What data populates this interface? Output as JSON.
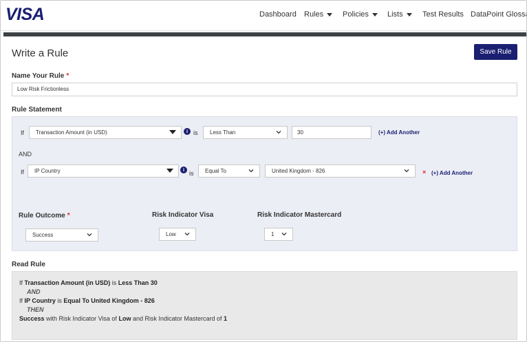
{
  "brand": {
    "logo_text": "VISA",
    "color": "#1a1f71"
  },
  "nav": {
    "items": [
      {
        "label": "Dashboard",
        "has_dropdown": false
      },
      {
        "label": "Rules",
        "has_dropdown": true
      },
      {
        "label": "Policies",
        "has_dropdown": true
      },
      {
        "label": "Lists",
        "has_dropdown": true
      },
      {
        "label": "Test Results",
        "has_dropdown": false
      },
      {
        "label": "DataPoint Glossary",
        "has_dropdown": false
      }
    ]
  },
  "page": {
    "title": "Write a Rule",
    "save_label": "Save Rule"
  },
  "name_section": {
    "label": "Name Your Rule",
    "required_marker": "*",
    "value": "Low Risk Frictionless"
  },
  "statement": {
    "label": "Rule Statement",
    "if_word": "If",
    "is_word": "is",
    "and_word": "AND",
    "conditions": [
      {
        "datapoint": "Transaction Amount (in USD)",
        "operator": "Less Than",
        "value": "30",
        "add_label": "(+) Add Another"
      },
      {
        "datapoint": "IP Country",
        "operator": "Equal To",
        "value": "United Kingdom - 826",
        "remove_label": "×",
        "add_label": "(+) Add Another"
      }
    ]
  },
  "outcome": {
    "outcome_label": "Rule Outcome",
    "required_marker": "*",
    "outcome_value": "Success",
    "visa_label": "Risk Indicator Visa",
    "visa_value": "Low",
    "mc_label": "Risk Indicator Mastercard",
    "mc_value": "1"
  },
  "read_rule": {
    "label": "Read Rule",
    "line1": {
      "if": "If",
      "field": "Transaction Amount (in USD)",
      "is": "is",
      "cond": "Less Than 30"
    },
    "and_kw": "AND",
    "line2": {
      "if": "If",
      "field": "IP Country",
      "is": "is",
      "cond": "Equal To United Kingdom - 826"
    },
    "then_kw": "THEN",
    "line3": {
      "outcome": "Success",
      "t1": "with Risk Indicator Visa of",
      "visa": "Low",
      "t2": "and Risk Indicator Mastercard of",
      "mc": "1"
    }
  },
  "colors": {
    "primary": "#1a1f71",
    "danger": "#d9292f",
    "panel": "#eceef5",
    "read_panel": "#e9e9e9",
    "bar": "#3d4247"
  },
  "icons": {
    "info": "info-circle-icon",
    "dropdown": "chevron-down-icon",
    "remove": "close-icon"
  }
}
